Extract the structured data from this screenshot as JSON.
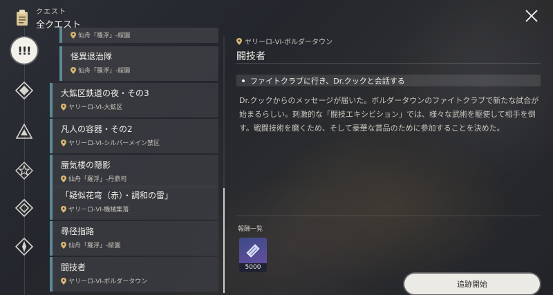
{
  "header": {
    "small_label": "クエスト",
    "title": "全クエスト"
  },
  "rail": {
    "active_label": "!!!",
    "icons": [
      "trailblaze-icon",
      "adventure-icon",
      "companion-icon",
      "daily-icon",
      "event-icon"
    ]
  },
  "quests": [
    {
      "title": "",
      "location": "仙舟「羅浮」-綏園",
      "inner": true,
      "partial": true
    },
    {
      "title": "怪異退治隊",
      "location": "仙舟「羅浮」-綏園",
      "inner": true
    },
    {
      "title": "大鉱区鉄道の夜・その3",
      "location": "ヤリーロ-VI-大鉱区"
    },
    {
      "title": "凡人の容器・その2",
      "location": "ヤリーロ-VI-シルバーメイン禁区"
    },
    {
      "title": "蜃気楼の隠影",
      "location": "仙舟「羅浮」-丹鼎司"
    },
    {
      "title": "「疑似花弯（赤）・調和の雷」",
      "location": "ヤリーロ-VI-機械集落"
    },
    {
      "title": "尋径指路",
      "location": "仙舟「羅浮」-綏園"
    },
    {
      "title": "闘技者",
      "location": "ヤリーロ-VI-ボルダータウン"
    }
  ],
  "detail": {
    "location": "ヤリーロ-VI-ボルダータウン",
    "title": "闘技者",
    "objective": "ファイトクラブに行き、Dr.クックと会話する",
    "description": "Dr.クックからのメッセージが届いた。ボルダータウンのファイトクラブで新たな試合が始まるらしい。刺激的な「闘技エキシビション」では、様々な武術を駆使して相手を倒す。戦闘技術を磨くため、そして豪華な賞品のために参加することを決めた。"
  },
  "rewards": {
    "label": "報酬一覧",
    "items": [
      {
        "icon": "credit-ticket-icon",
        "quantity": "5000"
      }
    ]
  },
  "actions": {
    "track_label": "追跡開始"
  },
  "colors": {
    "accent": "#5c8a98",
    "button": "#eceae4"
  }
}
